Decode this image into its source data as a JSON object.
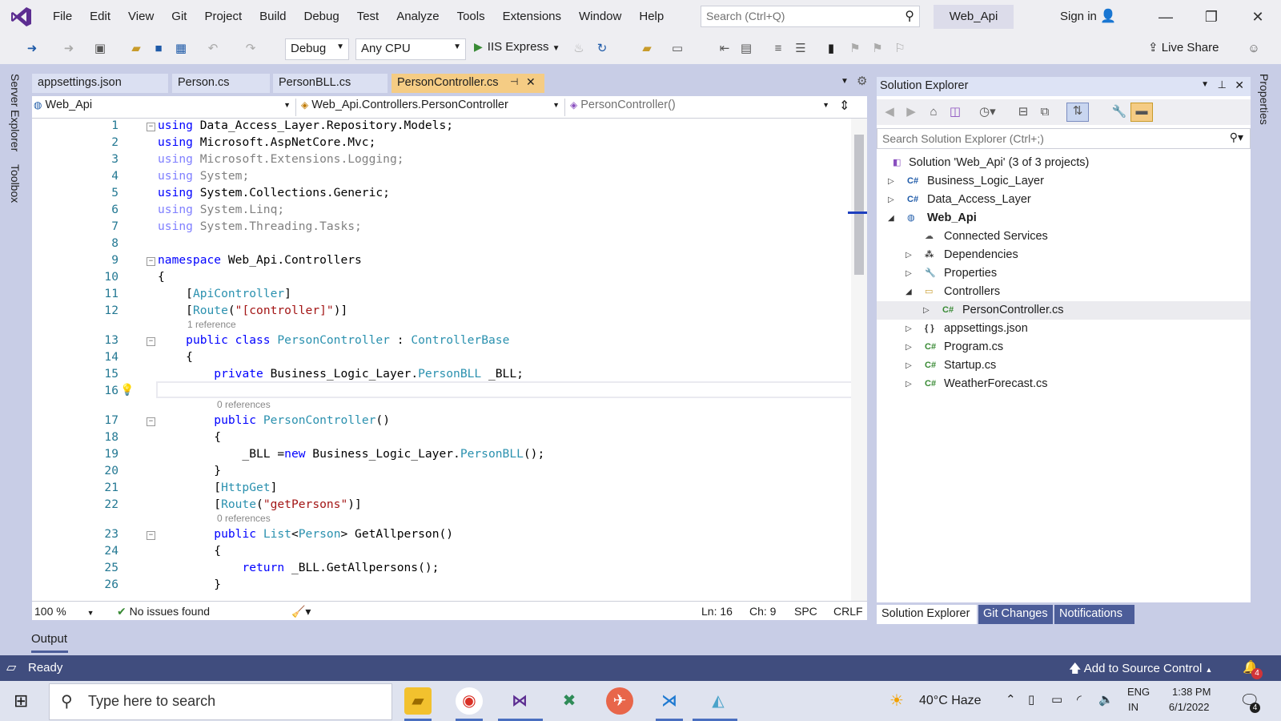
{
  "menu": {
    "items": [
      "File",
      "Edit",
      "View",
      "Git",
      "Project",
      "Build",
      "Debug",
      "Test",
      "Analyze",
      "Tools",
      "Extensions",
      "Window",
      "Help"
    ],
    "search_placeholder": "Search (Ctrl+Q)",
    "solution_name": "Web_Api",
    "sign_in": "Sign in"
  },
  "toolbar": {
    "config": "Debug",
    "platform": "Any CPU",
    "run_target": "IIS Express",
    "live_share": "Live Share"
  },
  "tabs": [
    {
      "label": "appsettings.json"
    },
    {
      "label": "Person.cs"
    },
    {
      "label": "PersonBLL.cs"
    },
    {
      "label": "PersonController.cs"
    }
  ],
  "navbar": {
    "project": "Web_Api",
    "type": "Web_Api.Controllers.PersonController",
    "member": "PersonController()"
  },
  "code": {
    "line_numbers": [
      "1",
      "2",
      "3",
      "4",
      "5",
      "6",
      "7",
      "8",
      "9",
      "10",
      "11",
      "12",
      "13",
      "14",
      "15",
      "16",
      "17",
      "18",
      "19",
      "20",
      "21",
      "22",
      "23",
      "24",
      "25",
      "26"
    ],
    "ref_1": "1 reference",
    "ref_0a": "0 references",
    "ref_0b": "0 references"
  },
  "editor_status": {
    "zoom": "100 %",
    "issues": "No issues found",
    "line": "Ln: 16",
    "col": "Ch: 9",
    "spacing": "SPC",
    "eol": "CRLF"
  },
  "solution_explorer": {
    "title": "Solution Explorer",
    "search_placeholder": "Search Solution Explorer (Ctrl+;)",
    "items": [
      {
        "label": "Solution 'Web_Api' (3 of 3 projects)",
        "icon": "solution-icon"
      },
      {
        "label": "Business_Logic_Layer",
        "icon": "csharp-project-icon"
      },
      {
        "label": "Data_Access_Layer",
        "icon": "csharp-project-icon"
      },
      {
        "label": "Web_Api",
        "icon": "web-project-icon"
      },
      {
        "label": "Connected Services",
        "icon": "connected-services-icon"
      },
      {
        "label": "Dependencies",
        "icon": "dependencies-icon"
      },
      {
        "label": "Properties",
        "icon": "properties-icon"
      },
      {
        "label": "Controllers",
        "icon": "folder-icon"
      },
      {
        "label": "PersonController.cs",
        "icon": "csharp-file-icon"
      },
      {
        "label": "appsettings.json",
        "icon": "json-file-icon"
      },
      {
        "label": "Program.cs",
        "icon": "csharp-file-icon"
      },
      {
        "label": "Startup.cs",
        "icon": "csharp-file-icon"
      },
      {
        "label": "WeatherForecast.cs",
        "icon": "csharp-file-icon"
      }
    ],
    "bottom_tabs": [
      "Solution Explorer",
      "Git Changes",
      "Notifications"
    ]
  },
  "rails": {
    "left": [
      "Server Explorer",
      "Toolbox"
    ],
    "right": [
      "Properties"
    ]
  },
  "output": {
    "label": "Output"
  },
  "statusbar": {
    "ready": "Ready",
    "source_control": "Add to Source Control",
    "notif_count": "4"
  },
  "taskbar": {
    "search_placeholder": "Type here to search",
    "weather_temp": "40°C",
    "weather_text": "Haze",
    "lang": "ENG",
    "region": "IN",
    "time": "1:38 PM",
    "date": "6/1/2022",
    "notif_count": "4"
  },
  "colors": {
    "accent": "#5c2d91",
    "active_tab": "#f5cc84",
    "statusbar": "#404d7e",
    "keyword": "#0000ff",
    "type": "#2b91af",
    "string": "#a31515"
  }
}
